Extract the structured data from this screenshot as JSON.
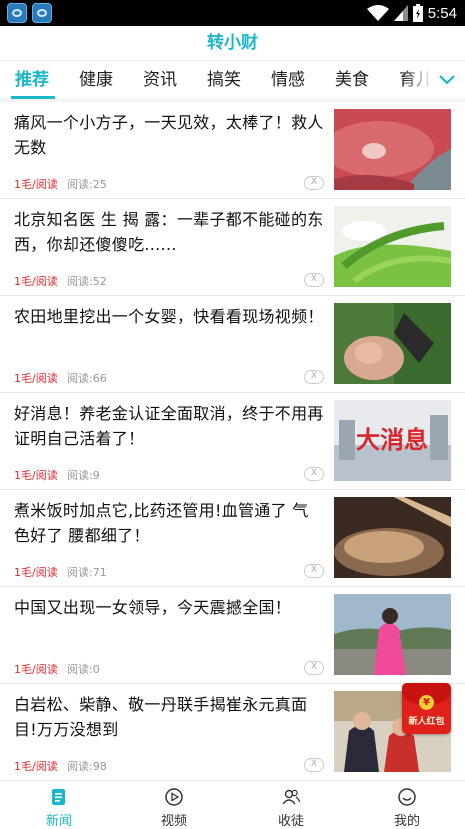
{
  "status_bar": {
    "time": "5:54"
  },
  "header": {
    "title": "转小财"
  },
  "tabs": [
    {
      "label": "推荐",
      "active": true
    },
    {
      "label": "健康"
    },
    {
      "label": "资讯"
    },
    {
      "label": "搞笑"
    },
    {
      "label": "情感"
    },
    {
      "label": "美食"
    },
    {
      "label": "育儿"
    }
  ],
  "news": [
    {
      "title": "痛风一个小方子，一天见效，太棒了！救人无数",
      "reward": "1毛/阅读",
      "reads": "阅读:25",
      "close": "X",
      "thumb": "lip-closeup-image"
    },
    {
      "title": "北京知名医 生 揭 露：一辈子都不能碰的东西，你却还傻傻吃......",
      "reward": "1毛/阅读",
      "reads": "阅读:52",
      "close": "X",
      "thumb": "green-vegetable-image"
    },
    {
      "title": "农田地里挖出一个女婴，快看看现场视频！",
      "reward": "1毛/阅读",
      "reads": "阅读:66",
      "close": "X",
      "thumb": "baby-image"
    },
    {
      "title": "好消息！养老金认证全面取消，终于不用再证明自己活着了！",
      "reward": "1毛/阅读",
      "reads": "阅读:9",
      "close": "X",
      "thumb": "big-news-image",
      "thumb_text": "大消息"
    },
    {
      "title": "煮米饭时加点它,比药还管用!血管通了 气色好了 腰都细了！",
      "reward": "1毛/阅读",
      "reads": "阅读:71",
      "close": "X",
      "thumb": "rice-image"
    },
    {
      "title": "中国又出现一女领导，今天震撼全国！",
      "reward": "1毛/阅读",
      "reads": "阅读:0",
      "close": "X",
      "thumb": "woman-pink-image"
    },
    {
      "title": "白岩松、柴静、敬一丹联手揭崔永元真面目!万万没想到",
      "reward": "1毛/阅读",
      "reads": "阅读:98",
      "close": "X",
      "thumb": "hosts-photo-image"
    }
  ],
  "red_packet": {
    "label": "新人红包",
    "coin": "¥"
  },
  "bottom_nav": [
    {
      "label": "新闻",
      "icon": "news-icon",
      "active": true
    },
    {
      "label": "视频",
      "icon": "play-icon"
    },
    {
      "label": "收徒",
      "icon": "users-icon"
    },
    {
      "label": "我的",
      "icon": "smile-icon"
    }
  ],
  "colors": {
    "accent": "#1cb8c8",
    "reward": "#e0282f",
    "red_packet": "#e0201b"
  }
}
